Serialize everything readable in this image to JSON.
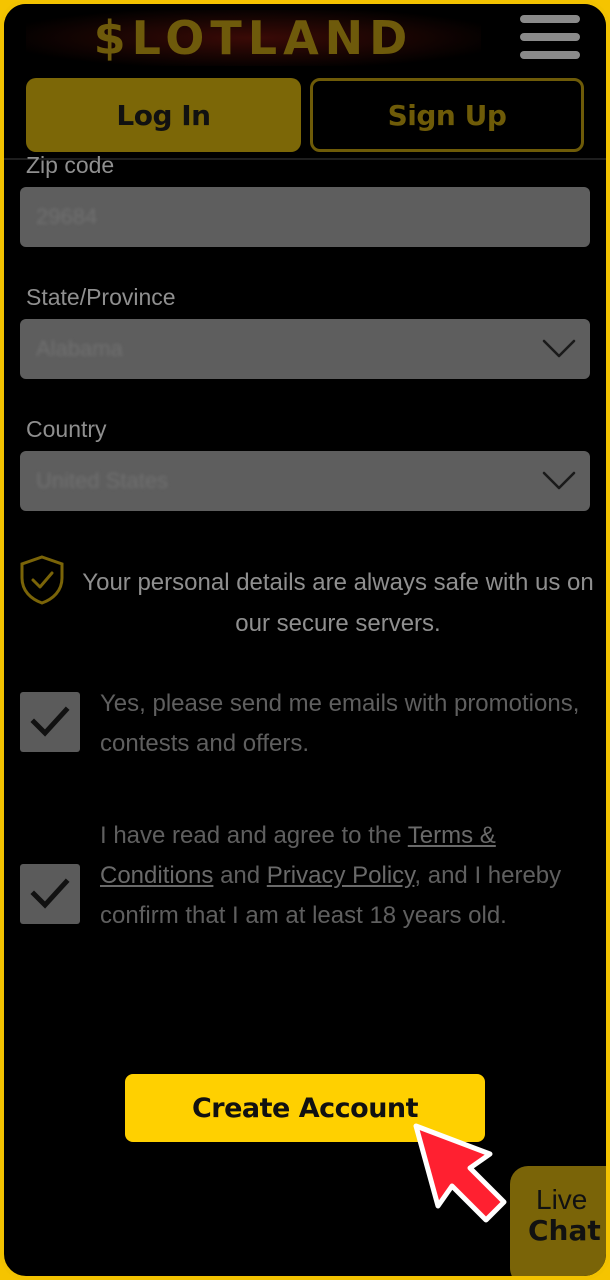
{
  "header": {
    "logo_text": "$LOTLAND",
    "menu_icon": "hamburger-menu-icon"
  },
  "auth": {
    "login_label": "Log In",
    "signup_label": "Sign Up"
  },
  "form": {
    "zip_label": "Zip code",
    "zip_value": "29684",
    "state_label": "State/Province",
    "state_value": "Alabama",
    "country_label": "Country",
    "country_value": "United States"
  },
  "secure": {
    "icon": "shield-check-icon",
    "text": "Your personal details are always safe with us on our secure servers."
  },
  "consent": {
    "emails_text": "Yes, please send me emails with promotions, contests and offers.",
    "emails_checked": true,
    "terms_prefix": "I have read and agree to the ",
    "terms_link": "Terms & Conditions",
    "terms_and": " and ",
    "privacy_link": "Privacy Policy",
    "terms_suffix": ", and I hereby confirm that I am at least 18 years old.",
    "terms_checked": true
  },
  "actions": {
    "create_label": "Create Account"
  },
  "live_chat": {
    "line1": "Live",
    "line2": "Chat"
  },
  "colors": {
    "accent": "#ffd000",
    "frame": "#f2c200",
    "background": "#000000"
  }
}
